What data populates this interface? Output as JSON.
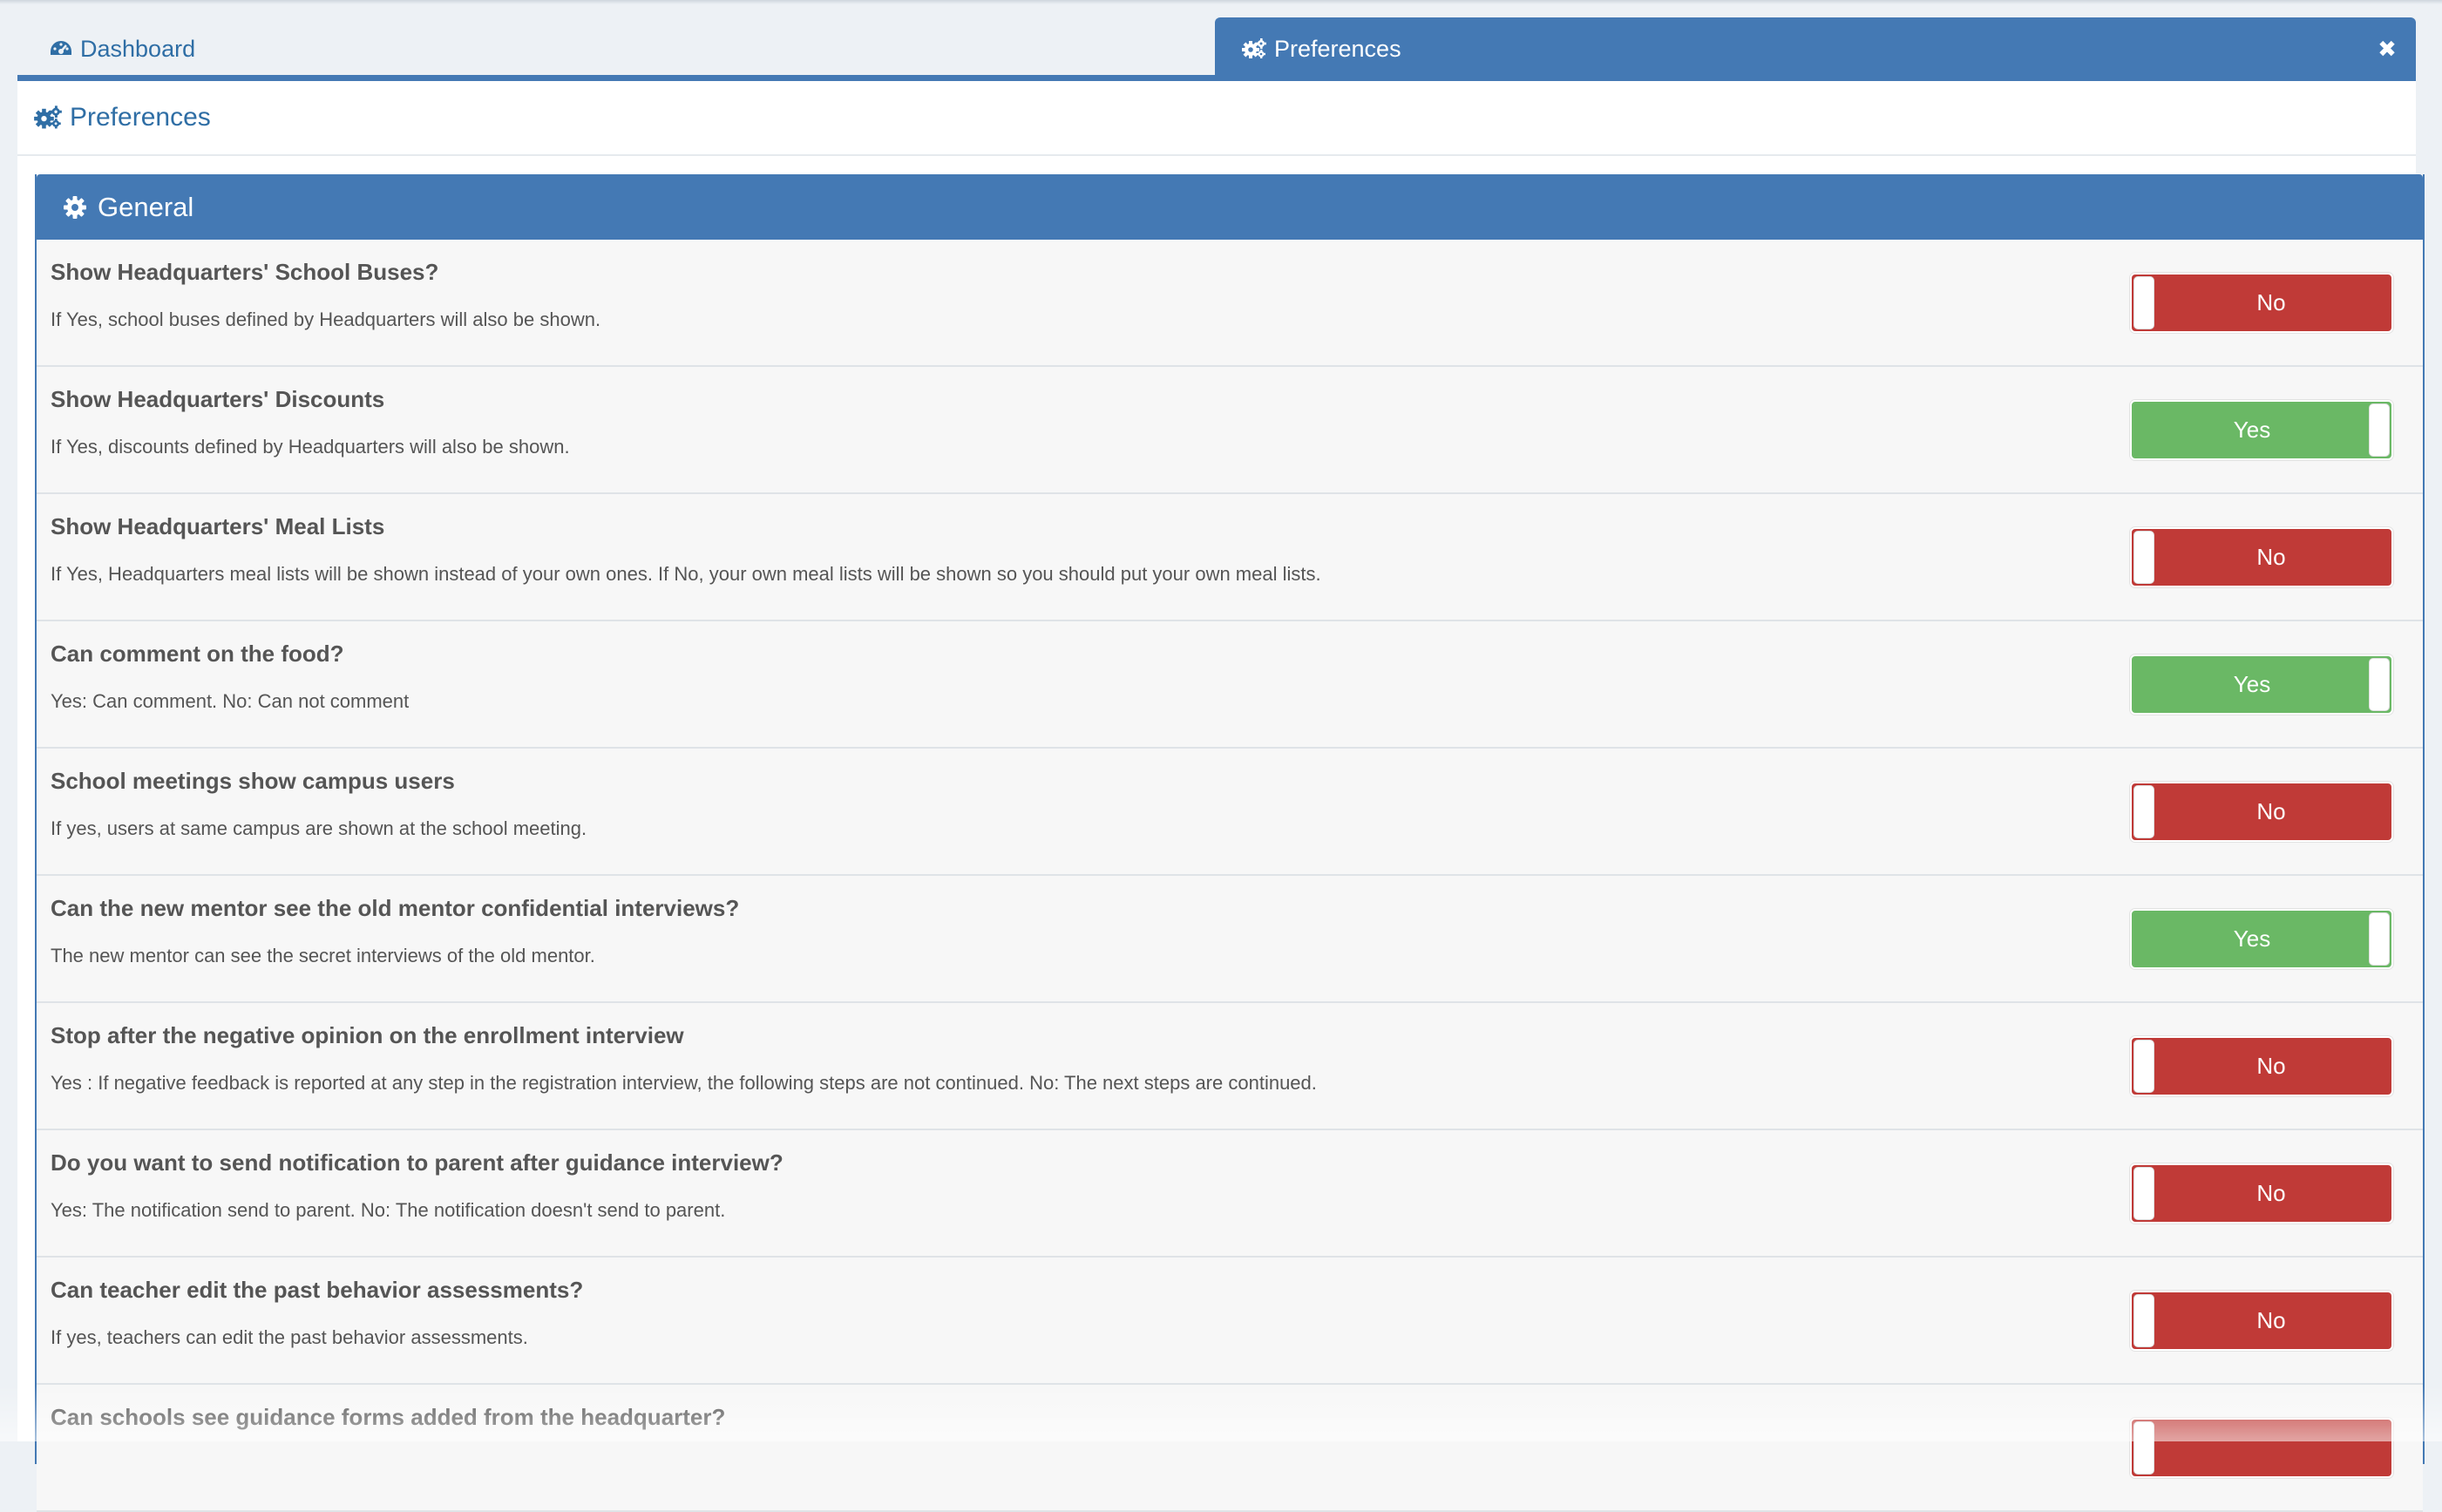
{
  "tabs": {
    "dashboard_label": "Dashboard",
    "preferences_label": "Preferences",
    "close_symbol": "✖"
  },
  "page": {
    "title": "Preferences"
  },
  "panel": {
    "title": "General"
  },
  "colors": {
    "brand": "#4479b4",
    "yes": "#6ab865",
    "no": "#c03a37"
  },
  "icons": {
    "dashboard_tab": "dashboard-icon",
    "preferences_tab": "cogs-icon",
    "page_title": "cogs-icon",
    "panel_title": "gear-icon",
    "tab_close": "close-icon"
  },
  "settings": [
    {
      "title": "Show Headquarters' School Buses?",
      "description": "If Yes, school buses defined by Headquarters will also be shown.",
      "state": "No"
    },
    {
      "title": "Show Headquarters' Discounts",
      "description": "If Yes, discounts defined by Headquarters will also be shown.",
      "state": "Yes"
    },
    {
      "title": "Show Headquarters' Meal Lists",
      "description": "If Yes, Headquarters meal lists will be shown instead of your own ones. If No, your own meal lists will be shown so you should put your own meal lists.",
      "state": "No"
    },
    {
      "title": "Can comment on the food?",
      "description": "Yes: Can comment. No: Can not comment",
      "state": "Yes"
    },
    {
      "title": "School meetings show campus users",
      "description": "If yes, users at same campus are shown at the school meeting.",
      "state": "No"
    },
    {
      "title": "Can the new mentor see the old mentor confidential interviews?",
      "description": "The new mentor can see the secret interviews of the old mentor.",
      "state": "Yes"
    },
    {
      "title": "Stop after the negative opinion on the enrollment interview",
      "description": "Yes : If negative feedback is reported at any step in the registration interview, the following steps are not continued. No: The next steps are continued.",
      "state": "No"
    },
    {
      "title": "Do you want to send notification to parent after guidance interview?",
      "description": "Yes: The notification send to parent. No: The notification doesn't send to parent.",
      "state": "No"
    },
    {
      "title": "Can teacher edit the past behavior assessments?",
      "description": "If yes, teachers can edit the past behavior assessments.",
      "state": "No"
    },
    {
      "title": "Can schools see guidance forms added from the headquarter?",
      "description": "",
      "state": ""
    }
  ]
}
